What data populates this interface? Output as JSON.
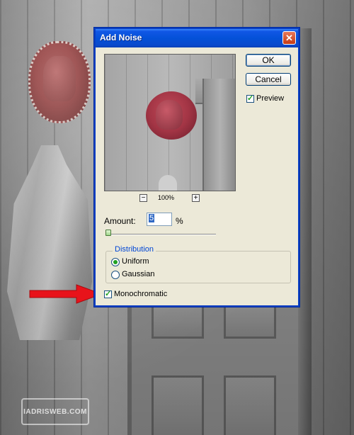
{
  "dialog": {
    "title": "Add Noise",
    "close_glyph": "✕",
    "ok_label": "OK",
    "cancel_label": "Cancel",
    "preview_label": "Preview",
    "preview_checked": true,
    "zoom": {
      "minus": "−",
      "value": "100%",
      "plus": "+"
    },
    "amount_label": "Amount:",
    "amount_value": "5",
    "amount_unit": "%",
    "amount_slider_fraction": 0.0125,
    "distribution": {
      "title": "Distribution",
      "options": [
        "Uniform",
        "Gaussian"
      ],
      "selected": "Uniform"
    },
    "monochromatic_label": "Monochromatic",
    "monochromatic_checked": true
  },
  "background": {
    "watermark": "IADRISWEB.COM"
  },
  "colors": {
    "title_bar": "#0451d8",
    "dialog_bg": "#ece9d8",
    "arrow": "#e8131b",
    "accent_check": "#21a121",
    "group_title": "#0046d5"
  },
  "icons": {
    "close": "close-icon",
    "check": "checkmark-icon",
    "arrow": "arrow-right-icon"
  }
}
